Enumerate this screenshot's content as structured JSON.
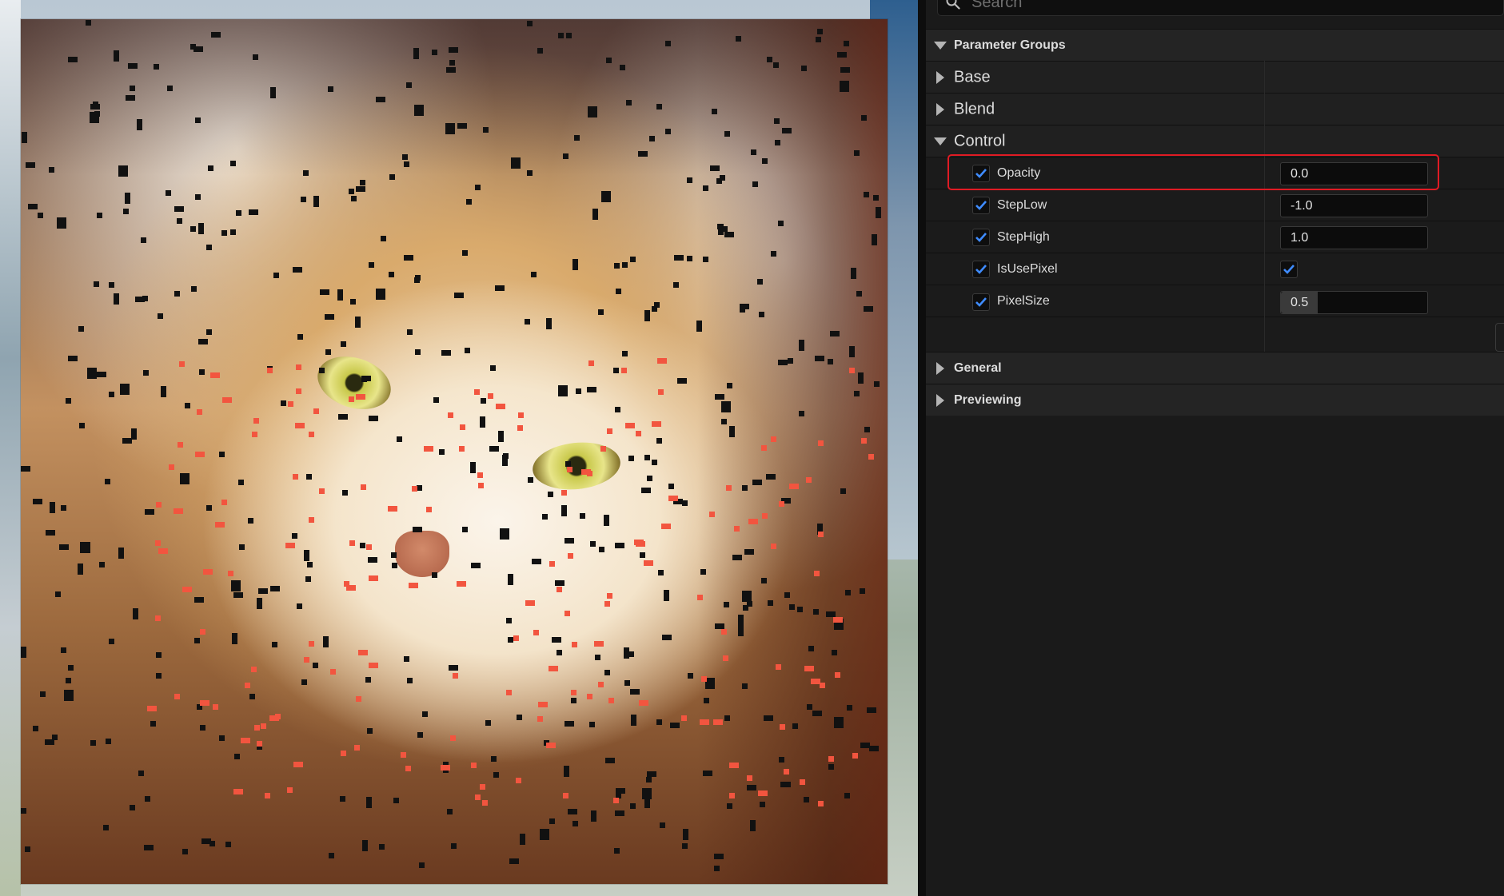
{
  "search": {
    "placeholder": "Search"
  },
  "details": {
    "parameter_groups_label": "Parameter Groups",
    "groups": [
      {
        "label": "Base",
        "expanded": false
      },
      {
        "label": "Blend",
        "expanded": false
      },
      {
        "label": "Control",
        "expanded": true
      }
    ],
    "control_params": [
      {
        "name": "Opacity",
        "enabled": true,
        "value": "0.0",
        "type": "number",
        "highlighted": true
      },
      {
        "name": "StepLow",
        "enabled": true,
        "value": "-1.0",
        "type": "number"
      },
      {
        "name": "StepHigh",
        "enabled": true,
        "value": "1.0",
        "type": "number"
      },
      {
        "name": "IsUsePixel",
        "enabled": true,
        "value": true,
        "type": "bool"
      },
      {
        "name": "PixelSize",
        "enabled": true,
        "value": "0.5",
        "type": "slider",
        "fraction": 0.5
      }
    ],
    "sections": [
      {
        "label": "General",
        "expanded": false
      },
      {
        "label": "Previewing",
        "expanded": false
      }
    ]
  },
  "colors": {
    "highlight_border": "#e01b24",
    "checkbox_check": "#3f8cff",
    "panel_bg": "#1a1a1a"
  },
  "icons": [
    "search-icon",
    "chevron-down-icon",
    "chevron-right-icon",
    "checkmark-icon"
  ]
}
